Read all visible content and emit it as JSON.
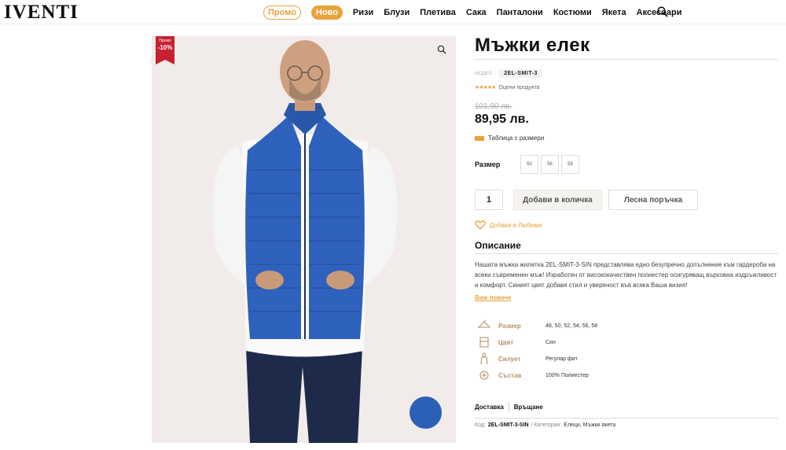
{
  "header": {
    "logo": "IVENTI",
    "nav": [
      {
        "label": "Промо"
      },
      {
        "label": "Ново"
      },
      {
        "label": "Ризи"
      },
      {
        "label": "Блузи"
      },
      {
        "label": "Плетива"
      },
      {
        "label": "Сака"
      },
      {
        "label": "Панталони"
      },
      {
        "label": "Костюми"
      },
      {
        "label": "Якета"
      },
      {
        "label": "Аксесоари"
      }
    ]
  },
  "product": {
    "promo_badge": {
      "label": "Промо",
      "discount": "-10%"
    },
    "title": "Мъжки елек",
    "model_label": "МОДЕЛ:",
    "model_code": "2EL-SMIT-3",
    "rating_text": "Оцени продукта",
    "old_price": "101,90 лв.",
    "price": "89,95 лв.",
    "size_table_label": "Таблица с размери",
    "size_label": "Размер",
    "sizes": [
      "50",
      "56",
      "58"
    ],
    "quantity": "1",
    "add_to_cart": "Добави в количка",
    "quick_order": "Лесна поръчка",
    "wishlist": "Добави в Любими",
    "description_title": "Описание",
    "description": "Нашата мъжка жилетка 2EL-SMIT-3-SIN представлява едно безупречно допълнение към гардероба на всеки съвременен мъж! Изработен от висококачествен полиестер осигуряващ върховна издръжливост и комфорт. Синият цвят добавя стил и увереност във всяка Ваша визия!",
    "read_more": "Виж повече",
    "specs": [
      {
        "icon": "hanger-icon",
        "label": "Размер",
        "value": "48, 50, 52, 54, 56, 58"
      },
      {
        "icon": "paint-icon",
        "label": "Цвят",
        "value": "Син"
      },
      {
        "icon": "silhouette-icon",
        "label": "Силует",
        "value": "Регулар фит"
      },
      {
        "icon": "fabric-icon",
        "label": "Състав",
        "value": "100% Полиестер"
      }
    ],
    "tabs": [
      "Доставка",
      "Връщане"
    ],
    "meta": {
      "code_label": "Код:",
      "code": "2EL-SMIT-3-SIN",
      "categories_label": "/ Категории:",
      "categories": "Елеци, Мъжки якета"
    }
  },
  "colors": {
    "accent": "#e8a33b",
    "promo_red": "#c7212f",
    "vest_blue": "#2c5fb8"
  }
}
